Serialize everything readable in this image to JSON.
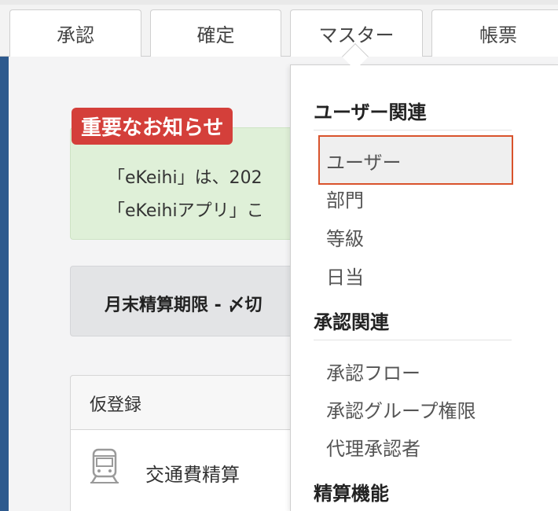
{
  "tabs": [
    {
      "label": "承認"
    },
    {
      "label": "確定"
    },
    {
      "label": "マスター"
    },
    {
      "label": "帳票"
    }
  ],
  "notice": {
    "badge": "重要なお知らせ",
    "line1": "「eKeihi」は、202",
    "line2": "「eKeihiアプリ」こ"
  },
  "deadline": {
    "text": "月末精算期限 - 〆切"
  },
  "panel": {
    "title": "仮登録",
    "item": "交通費精算",
    "item_icon": "train-icon"
  },
  "dropdown": {
    "sections": [
      {
        "heading": "ユーザー関連",
        "items": [
          "ユーザー",
          "部門",
          "等級",
          "日当"
        ]
      },
      {
        "heading": "承認関連",
        "items": [
          "承認フロー",
          "承認グループ権限",
          "代理承認者"
        ]
      },
      {
        "heading": "精算機能",
        "items": []
      }
    ],
    "highlighted_item": "ユーザー",
    "highlight_color": "#d9532c"
  },
  "colors": {
    "sidebar": "#2e5a8e",
    "badge": "#d43f3a",
    "notice_bg": "#dff0d8"
  }
}
